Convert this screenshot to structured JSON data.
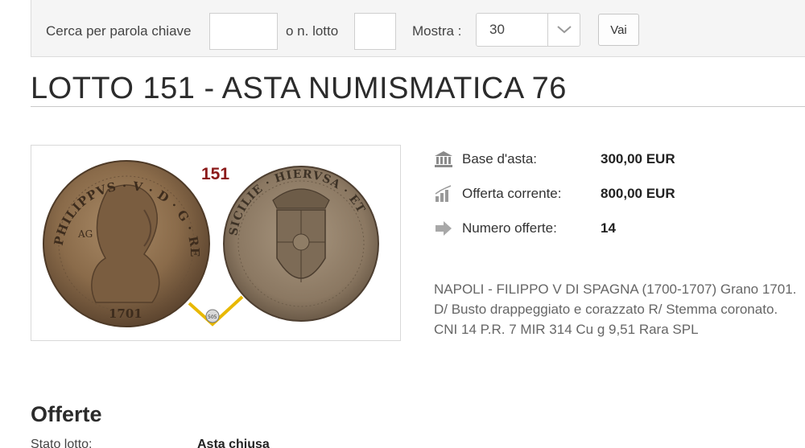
{
  "search": {
    "keyword_label": "Cerca per parola chiave",
    "keyword_value": "",
    "lot_label": "o n. lotto",
    "lot_value": "",
    "show_label": "Mostra :",
    "show_value": "30",
    "go_label": "Vai"
  },
  "page_title": "LOTTO 151 - ASTA NUMISMATICA 76",
  "coin_image": {
    "lot_number": "151",
    "obverse_legend": "PHILIPPVS · V · D · G · REX",
    "obverse_date": "1701",
    "obverse_mark": "AG",
    "reverse_legend": "SICILIE · HIERVSA · ET",
    "stamp_text": "505"
  },
  "info": {
    "base_label": "Base d'asta:",
    "base_value": "300,00 EUR",
    "current_label": "Offerta corrente:",
    "current_value": "800,00 EUR",
    "count_label": "Numero offerte:",
    "count_value": "14",
    "icons": [
      "bank-icon",
      "chart-icon",
      "arrow-right-icon"
    ]
  },
  "description": "NAPOLI - FILIPPO V DI SPAGNA (1700-1707) Grano 1701. D/ Busto drappeggiato e corazzato R/ Stemma coronato. CNI 14 P.R. 7 MIR 314 Cu g 9,51 Rara SPL",
  "offers": {
    "title": "Offerte",
    "status_label": "Stato lotto:",
    "status_value": "Asta chiusa"
  },
  "colors": {
    "lot_number": "#8b1a1a",
    "coin_bronze": "#8a6b4a",
    "stamp_gold": "#e8b800"
  }
}
